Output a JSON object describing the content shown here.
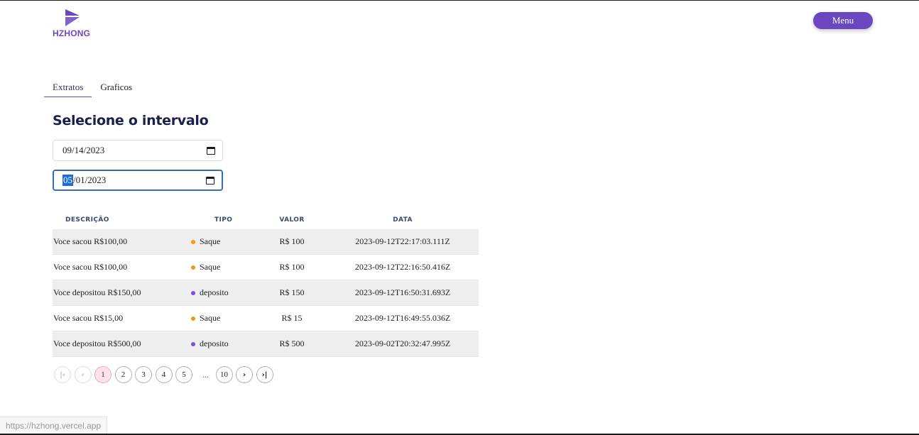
{
  "brand": {
    "name": "HZHONG",
    "color": "#6b46c1"
  },
  "header": {
    "menu_label": "Menu"
  },
  "tabs": [
    {
      "label": "Extratos",
      "active": true
    },
    {
      "label": "Graficos",
      "active": false
    }
  ],
  "filter": {
    "title": "Selecione o intervalo",
    "start_date": "09/14/2023",
    "end_date_selected": "05",
    "end_date_rest": "/01/2023"
  },
  "table": {
    "headers": {
      "description": "DESCRIÇÃO",
      "type": "TIPO",
      "value": "VALOR",
      "date": "DATA"
    },
    "rows": [
      {
        "description": "Voce sacou R$100,00",
        "type": "Saque",
        "type_color": "#f5941e",
        "value": "R$ 100",
        "date": "2023-09-12T22:17:03.111Z"
      },
      {
        "description": "Voce sacou R$100,00",
        "type": "Saque",
        "type_color": "#f5941e",
        "value": "R$ 100",
        "date": "2023-09-12T22:16:50.416Z"
      },
      {
        "description": "Voce depositou R$150,00",
        "type": "deposito",
        "type_color": "#7b52d6",
        "value": "R$ 150",
        "date": "2023-09-12T16:50:31.693Z"
      },
      {
        "description": "Voce sacou R$15,00",
        "type": "Saque",
        "type_color": "#f5941e",
        "value": "R$ 15",
        "date": "2023-09-12T16:49:55.036Z"
      },
      {
        "description": "Voce depositou R$500,00",
        "type": "deposito",
        "type_color": "#7b52d6",
        "value": "R$ 500",
        "date": "2023-09-02T20:32:47.995Z"
      }
    ]
  },
  "pagination": {
    "first_icon": "first-page-icon",
    "prev_icon": "chevron-left-icon",
    "pages": [
      "1",
      "2",
      "3",
      "4",
      "5"
    ],
    "current": "1",
    "ellipsis": "...",
    "last_page": "10",
    "next_icon": "chevron-right-icon",
    "last_icon": "last-page-icon"
  },
  "status_bar": {
    "url": "https://hzhong.vercel.app"
  }
}
